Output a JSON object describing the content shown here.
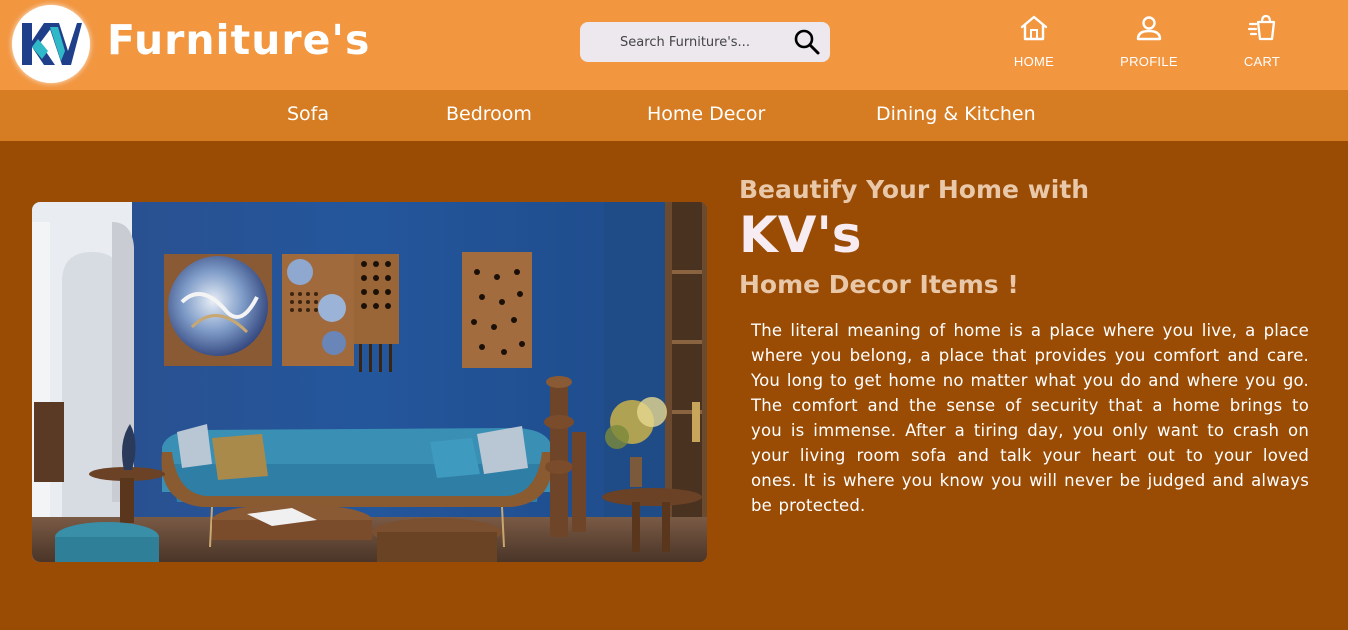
{
  "header": {
    "logo_text": "KV",
    "brand": "Furniture's",
    "search": {
      "placeholder": "Search Furniture's..."
    },
    "nav": [
      {
        "label": "HOME",
        "icon": "home-icon"
      },
      {
        "label": "PROFILE",
        "icon": "user-icon"
      },
      {
        "label": "CART",
        "icon": "cart-icon"
      }
    ]
  },
  "categories": [
    "Sofa",
    "Bedroom",
    "Home Decor",
    "Dining & Kitchen"
  ],
  "hero": {
    "subtitle_top": "Beautify Your Home with",
    "title": "KV's",
    "subtitle_bottom": "Home Decor Items !",
    "paragraph": "The literal meaning of home is a place where you live, a place where you belong, a place that provides you comfort and care. You long to get home no matter what you do and where you go. The comfort and the sense of security that a home brings to you is immense. After a tiring day, you only want to crash on your living room sofa and talk your heart out to your loved ones. It is where you know you will never be judged and always be protected."
  },
  "colors": {
    "header_bg": "#f29640",
    "category_bg": "#d67c22",
    "body_bg": "#9a4b04",
    "heading_accent": "#e8c8a8"
  }
}
